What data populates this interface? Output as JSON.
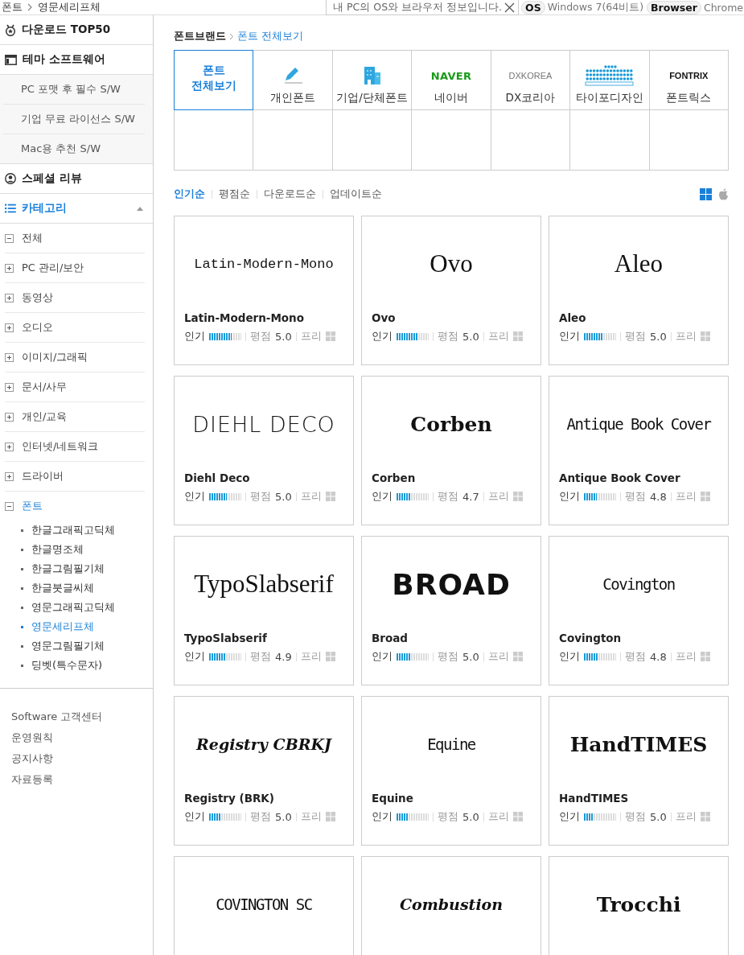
{
  "breadcrumb": [
    "폰트",
    "영문세리프체"
  ],
  "env_info": {
    "message": "내 PC의 OS와 브라우저 정보입니다.",
    "os_label": "OS",
    "os": "Windows 7(64비트)",
    "browser_label": "Browser",
    "browser": "Chrome"
  },
  "sidebar": {
    "main_items": [
      {
        "kind": "medal",
        "label": "다운로드 TOP50"
      },
      {
        "kind": "window",
        "label": "테마 소프트웨어",
        "children": [
          "PC 포맷 후 필수 S/W",
          "기업 무료 라이선스 S/W",
          "Mac용 추천 S/W"
        ]
      },
      {
        "kind": "person",
        "label": "스페셜 리뷰"
      }
    ],
    "category_header": {
      "label": "카테고리",
      "expanded": true
    },
    "categories": [
      {
        "label": "전체",
        "expanded": true,
        "selected": false
      },
      {
        "label": "PC 관리/보안",
        "expanded": false,
        "selected": false
      },
      {
        "label": "동영상",
        "expanded": false,
        "selected": false
      },
      {
        "label": "오디오",
        "expanded": false,
        "selected": false
      },
      {
        "label": "이미지/그래픽",
        "expanded": false,
        "selected": false
      },
      {
        "label": "문서/사무",
        "expanded": false,
        "selected": false
      },
      {
        "label": "개인/교육",
        "expanded": false,
        "selected": false
      },
      {
        "label": "인터넷/네트워크",
        "expanded": false,
        "selected": false
      },
      {
        "label": "드라이버",
        "expanded": false,
        "selected": false
      },
      {
        "label": "폰트",
        "expanded": true,
        "selected": true,
        "children": [
          {
            "label": "한글그래픽고딕체",
            "selected": false
          },
          {
            "label": "한글명조체",
            "selected": false
          },
          {
            "label": "한글그림필기체",
            "selected": false
          },
          {
            "label": "한글붓글씨체",
            "selected": false
          },
          {
            "label": "영문그래픽고딕체",
            "selected": false
          },
          {
            "label": "영문세리프체",
            "selected": true
          },
          {
            "label": "영문그림필기체",
            "selected": false
          },
          {
            "label": "딩벳(특수문자)",
            "selected": false
          }
        ]
      }
    ],
    "footer_links": [
      "Software 고객센터",
      "운영원칙",
      "공지사항",
      "자료등록"
    ]
  },
  "brand_path": [
    "폰트브랜드",
    "폰트 전체보기"
  ],
  "brands": [
    {
      "kind": "all",
      "label": "폰트\n전체보기",
      "selected": true
    },
    {
      "kind": "pencil",
      "label": "개인폰트",
      "selected": false
    },
    {
      "kind": "building",
      "label": "기업/단체폰트",
      "selected": false
    },
    {
      "kind": "naver",
      "logo": "NAVER",
      "label": "네이버",
      "selected": false
    },
    {
      "kind": "dxkorea",
      "logo": "DXKOREA",
      "label": "DX코리아",
      "selected": false
    },
    {
      "kind": "dots",
      "label": "타이포디자인",
      "selected": false
    },
    {
      "kind": "fontrix",
      "logo": "FONTRIX",
      "label": "폰트릭스",
      "selected": false
    }
  ],
  "sort_options": [
    {
      "label": "인기순",
      "selected": true
    },
    {
      "label": "평점순",
      "selected": false
    },
    {
      "label": "다운로드순",
      "selected": false
    },
    {
      "label": "업데이트순",
      "selected": false
    }
  ],
  "platform_filters": [
    {
      "kind": "windows",
      "selected": true
    },
    {
      "kind": "apple",
      "selected": false
    }
  ],
  "fonts": [
    {
      "preview": "Latin-Modern-Mono",
      "kind": "mono",
      "name": "Latin-Modern-Mono",
      "popularity_label": "인기",
      "level": 0.7,
      "rating_label": "평점",
      "rating": "5.0",
      "price": "프리"
    },
    {
      "preview": "Ovo",
      "kind": "serif",
      "name": "Ovo",
      "popularity_label": "인기",
      "level": 0.65,
      "rating_label": "평점",
      "rating": "5.0",
      "price": "프리"
    },
    {
      "preview": "Aleo",
      "kind": "serif",
      "name": "Aleo",
      "popularity_label": "인기",
      "level": 0.6,
      "rating_label": "평점",
      "rating": "5.0",
      "price": "프리"
    },
    {
      "preview": "DIEHL DECO",
      "kind": "thin",
      "name": "Diehl Deco",
      "popularity_label": "인기",
      "level": 0.55,
      "rating_label": "평점",
      "rating": "5.0",
      "price": "프리"
    },
    {
      "preview": "Corben",
      "kind": "boldserif",
      "name": "Corben",
      "popularity_label": "인기",
      "level": 0.45,
      "rating_label": "평점",
      "rating": "4.7",
      "price": "프리"
    },
    {
      "preview": "Antique Book Cover",
      "kind": "condensed",
      "name": "Antique Book Cover",
      "popularity_label": "인기",
      "level": 0.4,
      "rating_label": "평점",
      "rating": "4.8",
      "price": "프리"
    },
    {
      "preview": "TypoSlabserif",
      "kind": "serif",
      "name": "TypoSlabserif",
      "popularity_label": "인기",
      "level": 0.5,
      "rating_label": "평점",
      "rating": "4.9",
      "price": "프리"
    },
    {
      "preview": "BROAD",
      "kind": "heavy",
      "name": "Broad",
      "popularity_label": "인기",
      "level": 0.45,
      "rating_label": "평점",
      "rating": "5.0",
      "price": "프리"
    },
    {
      "preview": "Covington",
      "kind": "condensed",
      "name": "Covington",
      "popularity_label": "인기",
      "level": 0.45,
      "rating_label": "평점",
      "rating": "4.8",
      "price": "프리"
    },
    {
      "preview": "Registry CBRKJ",
      "kind": "script",
      "name": "Registry (BRK)",
      "popularity_label": "인기",
      "level": 0.35,
      "rating_label": "평점",
      "rating": "5.0",
      "price": "프리"
    },
    {
      "preview": "Equine",
      "kind": "condensed",
      "name": "Equine",
      "popularity_label": "인기",
      "level": 0.35,
      "rating_label": "평점",
      "rating": "5.0",
      "price": "프리"
    },
    {
      "preview": "HandTIMES",
      "kind": "boldserif",
      "name": "HandTIMES",
      "popularity_label": "인기",
      "level": 0.3,
      "rating_label": "평점",
      "rating": "5.0",
      "price": "프리"
    },
    {
      "preview": "COVINGTON SC",
      "kind": "condensed"
    },
    {
      "preview": "Combustion",
      "kind": "script"
    },
    {
      "preview": "Trocchi",
      "kind": "boldserif"
    }
  ]
}
